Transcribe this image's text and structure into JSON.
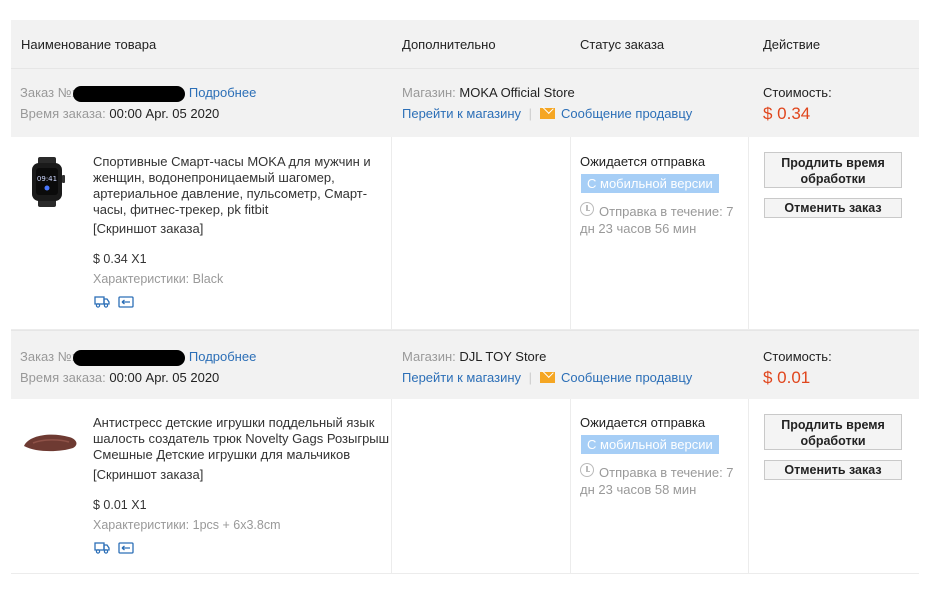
{
  "header": {
    "col_name": "Наименование товара",
    "col_extra": "Дополнительно",
    "col_status": "Статус заказа",
    "col_action": "Действие"
  },
  "orders": [
    {
      "order_label": "Заказ №:",
      "details_link": "Подробнее",
      "time_label": "Время заказа:",
      "time_value": "00:00 Apr. 05 2020",
      "store_label": "Магазин:",
      "store_name": "MOKA Official Store",
      "go_to_store": "Перейти к магазину",
      "message_seller": "Сообщение продавцу",
      "cost_label": "Стоимость:",
      "cost_value": "$ 0.34",
      "product_title": "Спортивные Смарт-часы MOKA для мужчин и женщин, водонепроницаемый шагомер, артериальное давление, пульсометр, Смарт-часы, фитнес-трекер, pk fitbit",
      "screenshot_link": "[Скриншот заказа]",
      "price_qty": "$ 0.34 X1",
      "specs": "Характеристики: Black",
      "status_title": "Ожидается отправка",
      "status_badge": "С мобильной версии",
      "eta": "Отправка в течение: 7 дн 23 часов 56 мин",
      "btn_extend": "Продлить время обработки",
      "btn_cancel": "Отменить заказ"
    },
    {
      "order_label": "Заказ №:",
      "details_link": "Подробнее",
      "time_label": "Время заказа:",
      "time_value": "00:00 Apr. 05 2020",
      "store_label": "Магазин:",
      "store_name": "DJL TOY Store",
      "go_to_store": "Перейти к магазину",
      "message_seller": "Сообщение продавцу",
      "cost_label": "Стоимость:",
      "cost_value": "$ 0.01",
      "product_title": "Антистресс детские игрушки поддельный язык шалость создатель трюк Novelty Gags Розыгрыш Смешные Детские игрушки для мальчиков",
      "screenshot_link": "[Скриншот заказа]",
      "price_qty": "$ 0.01 X1",
      "specs": "Характеристики: 1pcs + 6x3.8cm",
      "status_title": "Ожидается отправка",
      "status_badge": "С мобильной версии",
      "eta": "Отправка в течение: 7 дн 23 часов 58 мин",
      "btn_extend": "Продлить время обработки",
      "btn_cancel": "Отменить заказ"
    }
  ],
  "icons": [
    "smartwatch-image",
    "fake-tongue-image",
    "delivery-truck-icon",
    "return-icon",
    "mail-icon",
    "clock-icon"
  ],
  "colors": {
    "link": "#2c6fb7",
    "price": "#e0461d",
    "badge": "#a6cef6",
    "header_bg": "#f2f2f2"
  }
}
